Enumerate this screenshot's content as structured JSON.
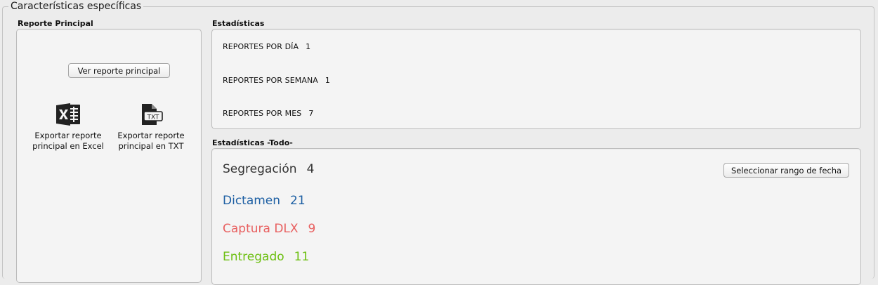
{
  "outer": {
    "legend": "Características específicas"
  },
  "reporte_principal": {
    "title": "Reporte Principal",
    "ver_button": "Ver reporte principal",
    "export_excel": {
      "line1": "Exportar reporte",
      "line2": "principal en Excel",
      "icon": "excel-icon"
    },
    "export_txt": {
      "line1": "Exportar reporte",
      "line2": "principal en TXT",
      "icon": "txt-file-icon"
    }
  },
  "estadisticas": {
    "title": "Estadísticas",
    "rows": [
      {
        "label": "REPORTES POR DÍA",
        "value": "1"
      },
      {
        "label": "REPORTES POR SEMANA",
        "value": "1"
      },
      {
        "label": "REPORTES POR MES",
        "value": "7"
      }
    ]
  },
  "estadisticas_todo": {
    "title": "Estadísticas -Todo-",
    "range_button": "Seleccionar rango de fecha",
    "rows": [
      {
        "label": "Segregación",
        "value": "4",
        "color": "#333333"
      },
      {
        "label": "Dictamen",
        "value": "21",
        "color": "#1d5fa3"
      },
      {
        "label": "Captura DLX",
        "value": "9",
        "color": "#e86060"
      },
      {
        "label": "Entregado",
        "value": "11",
        "color": "#6cbf10"
      }
    ]
  }
}
